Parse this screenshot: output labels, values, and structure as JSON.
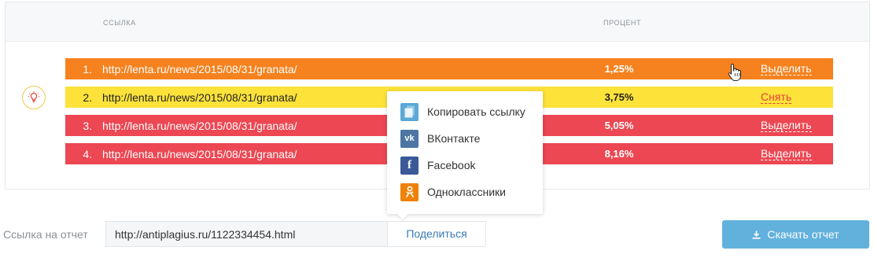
{
  "table": {
    "col_link": "ССЫЛКА",
    "col_percent": "ПРОЦЕНТ",
    "rows": [
      {
        "num": "1.",
        "url": "http://lenta.ru/news/2015/08/31/granata/",
        "percent": "1,25%",
        "action": "Выделить",
        "color": "#f5821f"
      },
      {
        "num": "2.",
        "url": "http://lenta.ru/news/2015/08/31/granata/",
        "percent": "3,75%",
        "action": "Снять",
        "color": "#fde23a"
      },
      {
        "num": "3.",
        "url": "http://lenta.ru/news/2015/08/31/granata/",
        "percent": "5,05%",
        "action": "Выделить",
        "color": "#ec4753"
      },
      {
        "num": "4.",
        "url": "http://lenta.ru/news/2015/08/31/granata/",
        "percent": "8,16%",
        "action": "Выделить",
        "color": "#ec4753"
      }
    ]
  },
  "share_menu": {
    "items": [
      {
        "label": "Копировать ссылку",
        "icon": "copy-icon",
        "color": "#5aa9d6"
      },
      {
        "label": "ВКонтакте",
        "icon": "vk-icon",
        "color": "#4c75a3"
      },
      {
        "label": "Facebook",
        "icon": "facebook-icon",
        "color": "#3b5998"
      },
      {
        "label": "Одноклассники",
        "icon": "odnoklassniki-icon",
        "color": "#ee8208"
      }
    ]
  },
  "report": {
    "label": "Ссылка на отчет",
    "link_value": "http://antiplagius.ru/1122334454.html",
    "share_label": "Поделиться",
    "download_label": "Скачать отчет"
  }
}
